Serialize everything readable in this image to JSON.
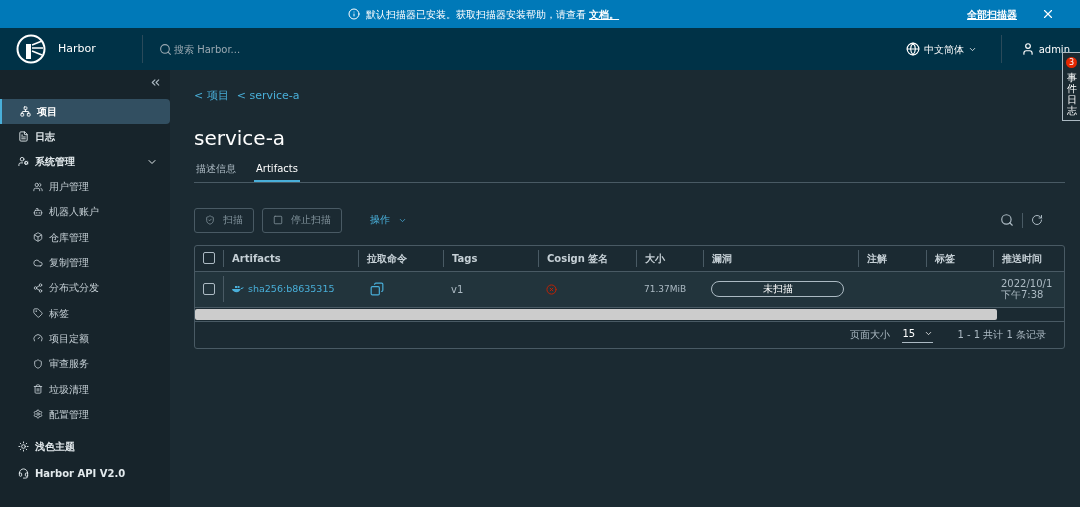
{
  "banner": {
    "message": "默认扫描器已安装。获取扫描器安装帮助，请查看",
    "link": "文档。",
    "action": "全部扫描器"
  },
  "header": {
    "brand": "Harbor",
    "search": {
      "placeholder": "搜索 Harbor..."
    },
    "language": "中文简体",
    "user": "admin"
  },
  "event_log": {
    "label": "事件日志",
    "count": "3"
  },
  "sidebar": {
    "items": [
      {
        "label": "项目",
        "selected": true
      },
      {
        "label": "日志",
        "selected": false
      },
      {
        "label": "系统管理",
        "selected": false,
        "expanded": true,
        "children": [
          {
            "label": "用户管理",
            "selected": false
          },
          {
            "label": "机器人账户",
            "selected": false
          },
          {
            "label": "仓库管理",
            "selected": false
          },
          {
            "label": "复制管理",
            "selected": false
          },
          {
            "label": "分布式分发",
            "selected": false
          },
          {
            "label": "标签",
            "selected": false
          },
          {
            "label": "项目定额",
            "selected": false
          },
          {
            "label": "审查服务",
            "selected": false
          },
          {
            "label": "垃圾清理",
            "selected": false
          },
          {
            "label": "配置管理",
            "selected": false
          }
        ]
      }
    ],
    "footer": [
      {
        "label": "浅色主题"
      },
      {
        "label": "Harbor API V2.0"
      }
    ]
  },
  "breadcrumbs": [
    "< 项目",
    "< service-a"
  ],
  "title": "service-a",
  "tabs": [
    {
      "label": "描述信息",
      "selected": false
    },
    {
      "label": "Artifacts",
      "selected": true
    }
  ],
  "toolbar": {
    "buttons": [
      "扫描",
      "停止扫描"
    ],
    "menu": "操作"
  },
  "table": {
    "all_checked": false,
    "columns": [
      "Artifacts",
      "拉取命令",
      "Tags",
      "Cosign 签名",
      "大小",
      "漏洞",
      "注解",
      "标签",
      "推送时间"
    ],
    "rows": [
      {
        "checked": false,
        "artifact": "sha256:b8635315",
        "tags": "v1",
        "signed": false,
        "size": "71.37MiB",
        "vulnerabilities": "未扫描",
        "push_time": [
          "2022/10/1",
          "下午7:38"
        ]
      }
    ],
    "footer": {
      "page_size_label": "页面大小",
      "page_size": "15",
      "summary": "1 - 1 共计 1 条记录"
    }
  }
}
